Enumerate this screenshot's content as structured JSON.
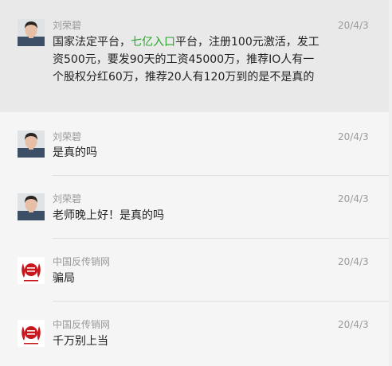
{
  "items": [
    {
      "user": "刘荣碧",
      "date": "20/4/3",
      "msg_before": "国家法定平台，",
      "msg_highlight": "七亿入口",
      "msg_after": "平台，注册100元激活，发工资500元，要发90天的工资45000万，推荐IO人有一个股权分红60万，推荐20人有120万到的是不是真的",
      "avatar": "person-photo",
      "selected": true
    },
    {
      "user": "刘荣碧",
      "date": "20/4/3",
      "msg": "是真的吗",
      "avatar": "person-photo"
    },
    {
      "user": "刘荣碧",
      "date": "20/4/3",
      "msg": "老师晚上好！是真的吗",
      "avatar": "person-photo"
    },
    {
      "user": "中国反传销网",
      "date": "20/4/3",
      "msg": "骗局",
      "avatar": "anti-mlm-seal"
    },
    {
      "user": "中国反传销网",
      "date": "20/4/3",
      "msg": "千万别上当",
      "avatar": "anti-mlm-seal"
    }
  ],
  "colors": {
    "highlight": "#2aa52a",
    "seal_red": "#c8161d",
    "selected_bg": "#e9e9e9"
  }
}
